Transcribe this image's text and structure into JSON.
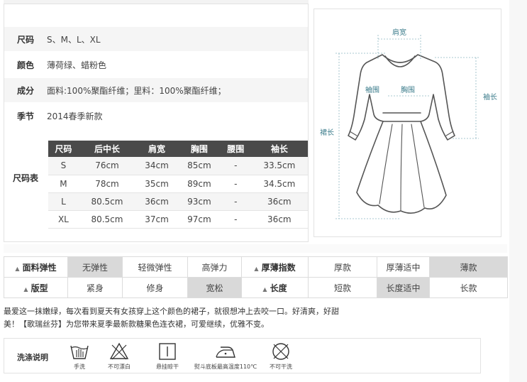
{
  "info": {
    "size_label": "尺码",
    "size_value": "S、M、L、XL",
    "color_label": "颜色",
    "color_value": "薄荷绿、蜡粉色",
    "material_label": "成分",
    "material_value": "面料:100%聚酯纤维；里料：100%聚酯纤维；",
    "season_label": "季节",
    "season_value": "2014春季新款",
    "size_chart_label": "尺码表"
  },
  "size_table": {
    "headers": [
      "尺码",
      "后中长",
      "肩宽",
      "胸围",
      "腰围",
      "袖长"
    ],
    "rows": [
      [
        "S",
        "76cm",
        "34cm",
        "85cm",
        "-",
        "33.5cm"
      ],
      [
        "M",
        "78cm",
        "35cm",
        "89cm",
        "-",
        "34.5cm"
      ],
      [
        "L",
        "80.5cm",
        "36cm",
        "93cm",
        "-",
        "36cm"
      ],
      [
        "XL",
        "80.5cm",
        "37cm",
        "97cm",
        "-",
        "36cm"
      ]
    ]
  },
  "diagram": {
    "shoulder": "肩宽",
    "sleeve_circ": "袖围",
    "chest": "胸围",
    "sleeve_length": "袖长",
    "skirt_length": "裙长"
  },
  "attributes": {
    "row1": {
      "group1_label": "面料弹性",
      "group1_options": [
        "无弹性",
        "轻微弹性",
        "高弹力"
      ],
      "group1_selected": 0,
      "group2_label": "厚薄指数",
      "group2_options": [
        "厚款",
        "厚薄适中",
        "薄款"
      ],
      "group2_selected": 2
    },
    "row2": {
      "group1_label": "版型",
      "group1_options": [
        "紧身",
        "修身",
        "宽松"
      ],
      "group1_selected": 2,
      "group2_label": "长度",
      "group2_options": [
        "短款",
        "长度适中",
        "长款"
      ],
      "group2_selected": 1
    }
  },
  "description": {
    "line1": "最爱这一抹嫩绿，每次看到夏天有女孩穿上这个颜色的裙子，就很想冲上去咬一口。好清爽，好甜",
    "line2": "美！【歌瑞丝芬】为您带来夏季最新款糖果色连衣裙，可爱继续，优雅不变。"
  },
  "care": {
    "title": "洗涤说明",
    "items": [
      {
        "icon": "hand-wash-icon",
        "label": "手洗"
      },
      {
        "icon": "no-bleach-icon",
        "label": "不可漂白"
      },
      {
        "icon": "hang-dry-icon",
        "label": "悬挂晾干"
      },
      {
        "icon": "iron-icon",
        "label": "熨斗底板最高温度110℃"
      },
      {
        "icon": "no-dry-clean-icon",
        "label": "不可干洗"
      }
    ]
  }
}
